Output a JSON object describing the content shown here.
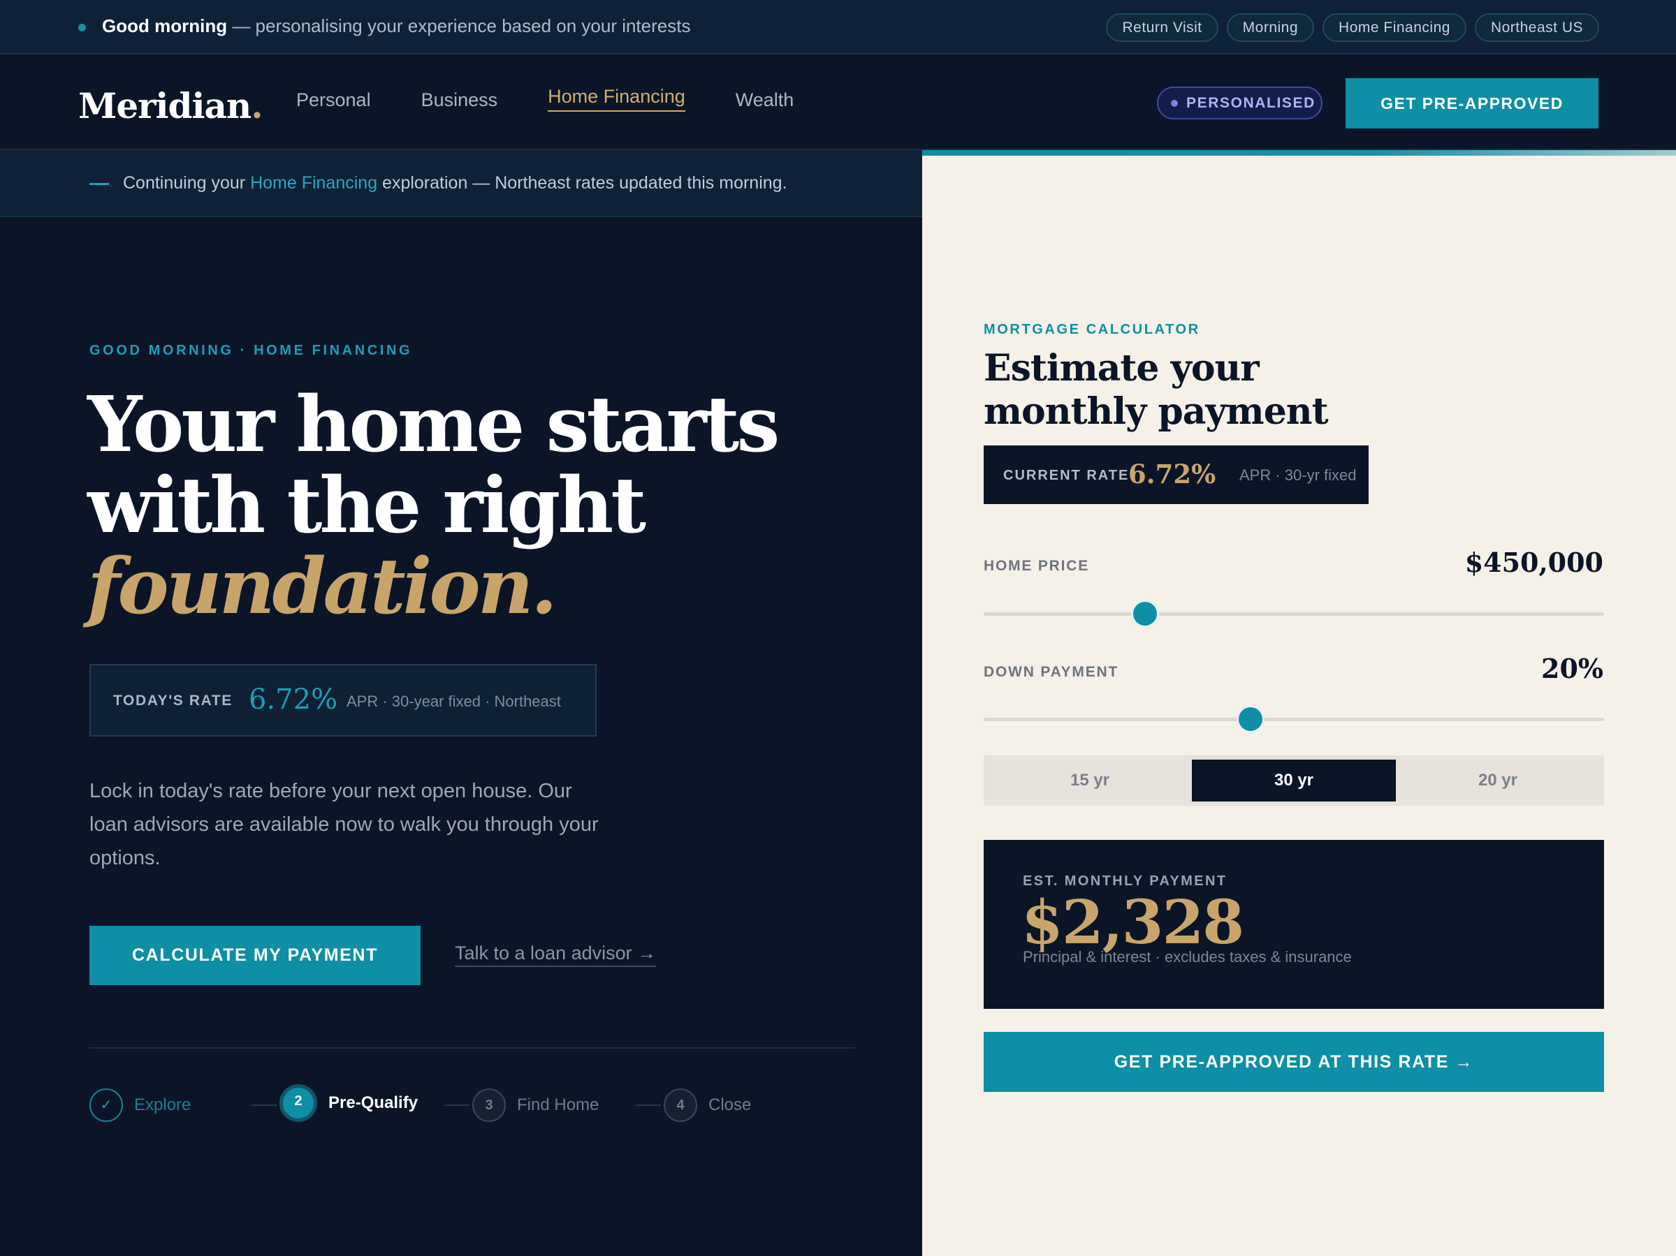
{
  "topbar": {
    "greeting_bold": "Good morning",
    "greeting_rest": " — personalising your experience based on your interests",
    "chips": [
      "Return Visit",
      "Morning",
      "Home Financing",
      "Northeast US"
    ]
  },
  "nav": {
    "logo": "Meridian",
    "logo_dot": ".",
    "links": [
      "Personal",
      "Business",
      "Home Financing",
      "Wealth"
    ],
    "active_link": "Home Financing",
    "badge": "PERSONALISED",
    "cta": "GET PRE-APPROVED"
  },
  "continue_bar": {
    "prefix": "Continuing your ",
    "highlight": "Home Financing",
    "suffix": " exploration — Northeast rates updated this morning."
  },
  "hero": {
    "eyebrow": "GOOD MORNING · HOME FINANCING",
    "line1": "Your home starts",
    "line2": "with the right",
    "accent": "foundation.",
    "rate_label": "TODAY'S RATE",
    "rate_value": "6.72%",
    "rate_note": "APR · 30-year fixed · Northeast",
    "lead": "Lock in today's rate before your next open house. Our loan advisors are available now to walk you through your options.",
    "cta_primary": "CALCULATE MY PAYMENT",
    "cta_secondary": "Talk to a loan advisor →"
  },
  "steps": [
    {
      "icon": "✓",
      "label": "Explore"
    },
    {
      "icon": "2",
      "label": "Pre-Qualify"
    },
    {
      "icon": "3",
      "label": "Find Home"
    },
    {
      "icon": "4",
      "label": "Close"
    }
  ],
  "calculator": {
    "eyebrow": "MORTGAGE CALCULATOR",
    "title_line1": "Estimate your",
    "title_line2": "monthly payment",
    "rate_label": "CURRENT RATE",
    "rate_value": "6.72%",
    "rate_note": "APR · 30-yr fixed",
    "home_price_label": "HOME PRICE",
    "home_price_value": "$450,000",
    "home_price_slider": 0.26,
    "down_payment_label": "DOWN PAYMENT",
    "down_payment_value": "20%",
    "down_payment_slider": 0.43,
    "terms": [
      "15 yr",
      "30 yr",
      "20 yr"
    ],
    "active_term": "30 yr",
    "monthly_label": "EST. MONTHLY PAYMENT",
    "monthly_value": "$2,328",
    "monthly_note": "Principal & interest · excludes taxes & insurance",
    "cta": "GET PRE-APPROVED AT THIS RATE →"
  },
  "colors": {
    "navy": "#0b1527",
    "teal": "#0e8fa5",
    "gold": "#c9a56b",
    "cream": "#f5f0e8"
  }
}
